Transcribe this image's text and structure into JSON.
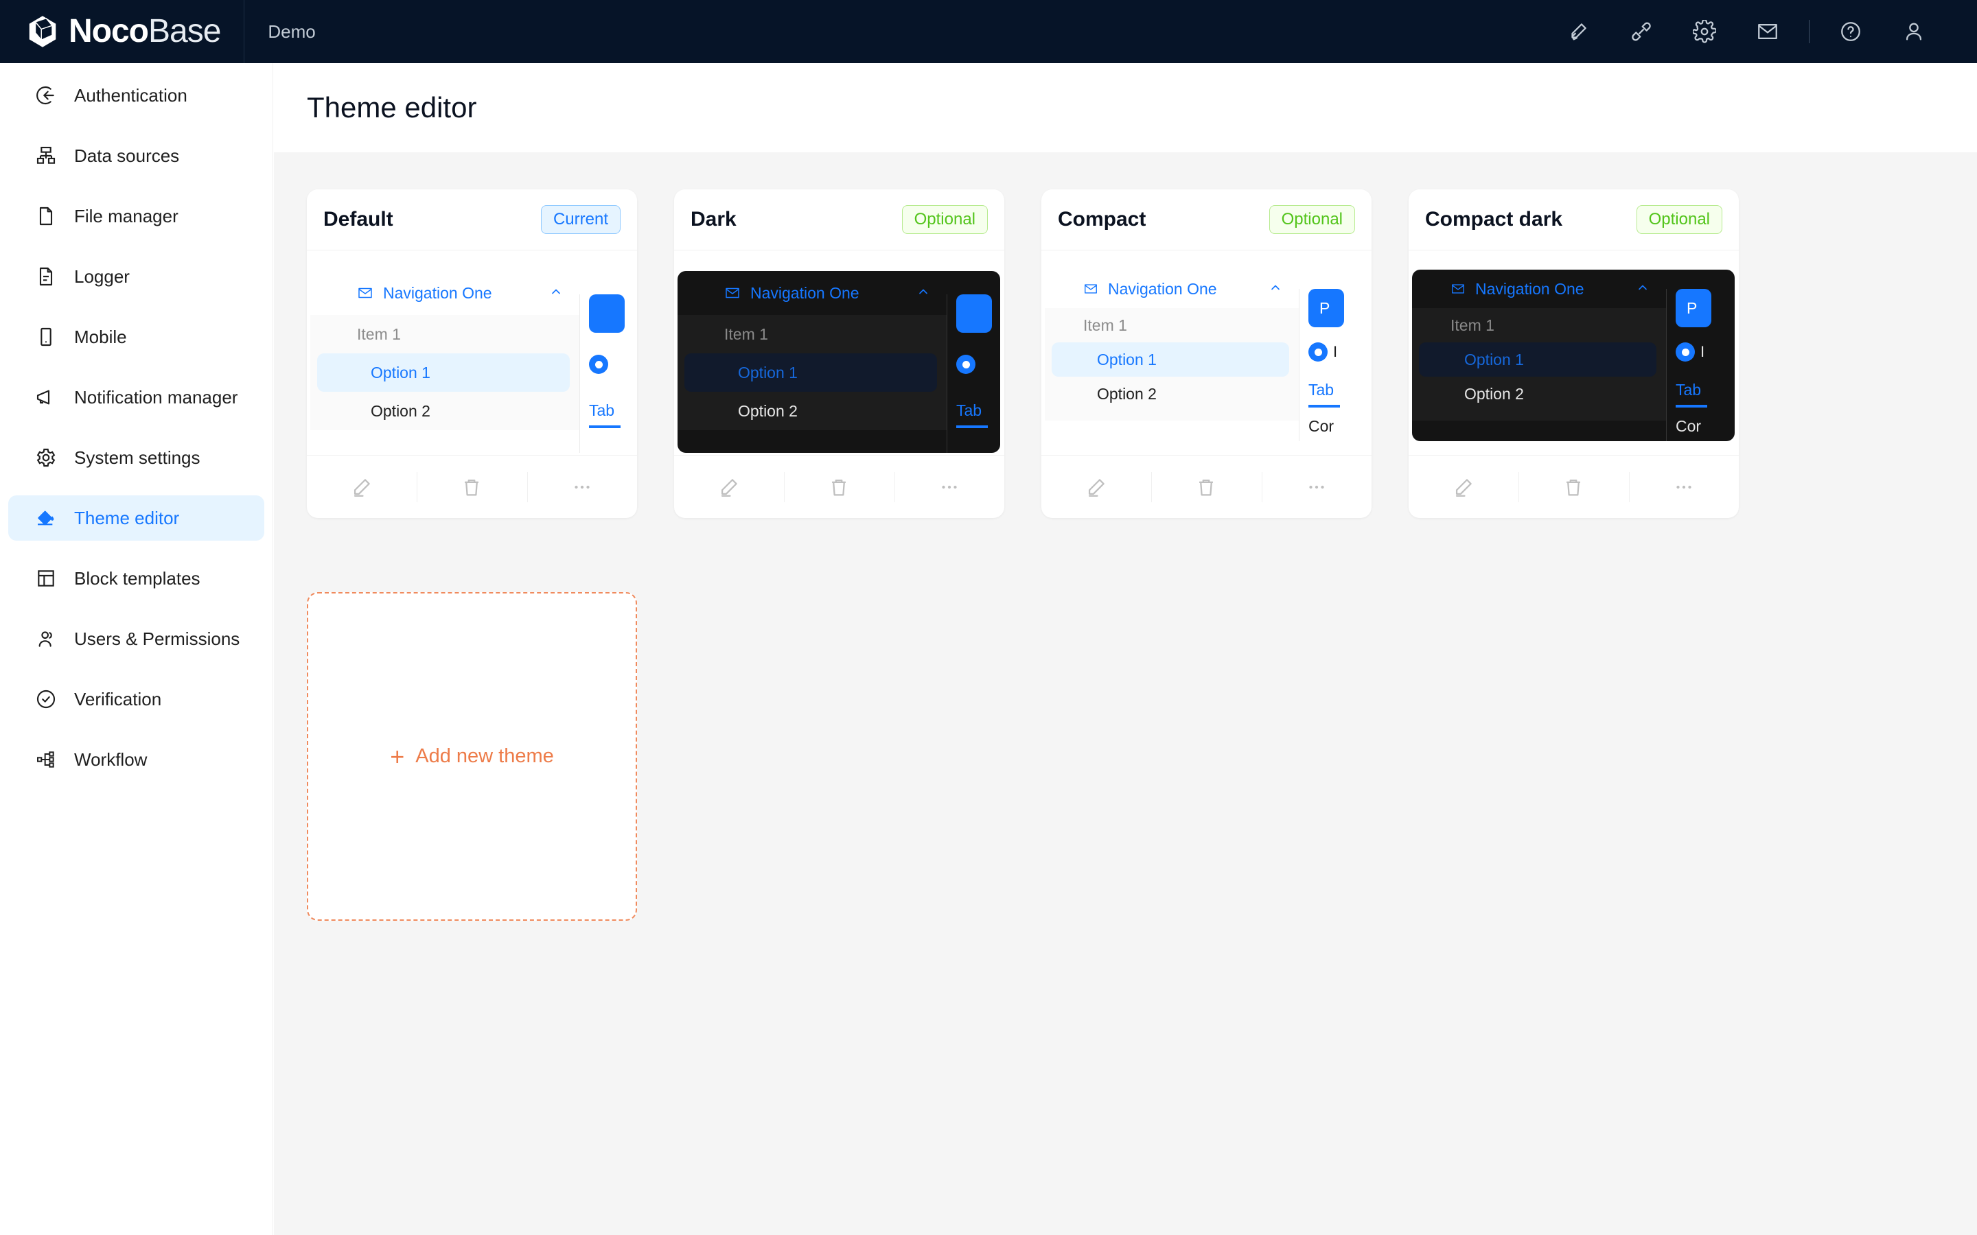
{
  "topbar": {
    "brand_primary": "Noco",
    "brand_secondary": "Base",
    "workspace": "Demo",
    "icons": [
      {
        "name": "highlighter-icon",
        "glyph": "pen"
      },
      {
        "name": "plugin-icon",
        "glyph": "plugin"
      },
      {
        "name": "gear-icon",
        "glyph": "gear"
      },
      {
        "name": "mail-icon",
        "glyph": "mail"
      },
      {
        "name": "help-icon",
        "glyph": "help"
      },
      {
        "name": "user-avatar-icon",
        "glyph": "user"
      }
    ],
    "brand_color": "#061428",
    "accent_color": "#1677ff"
  },
  "sidebar": {
    "items": [
      {
        "label": "Authentication",
        "icon": "login-icon",
        "active": false
      },
      {
        "label": "Data sources",
        "icon": "database-tree-icon",
        "active": false
      },
      {
        "label": "File manager",
        "icon": "file-icon",
        "active": false
      },
      {
        "label": "Logger",
        "icon": "file-lines-icon",
        "active": false
      },
      {
        "label": "Mobile",
        "icon": "mobile-icon",
        "active": false
      },
      {
        "label": "Notification manager",
        "icon": "megaphone-icon",
        "active": false
      },
      {
        "label": "System settings",
        "icon": "gear-icon",
        "active": false
      },
      {
        "label": "Theme editor",
        "icon": "paint-bucket-icon",
        "active": true
      },
      {
        "label": "Block templates",
        "icon": "layout-icon",
        "active": false
      },
      {
        "label": "Users & Permissions",
        "icon": "users-icon",
        "active": false
      },
      {
        "label": "Verification",
        "icon": "check-circle-icon",
        "active": false
      },
      {
        "label": "Workflow",
        "icon": "workflow-icon",
        "active": false
      }
    ],
    "active_bg": "#e6f4ff",
    "active_color": "#1677ff"
  },
  "page": {
    "title": "Theme editor",
    "background": "#f5f5f5"
  },
  "preview_labels": {
    "nav": "Navigation One",
    "item": "Item 1",
    "option1": "Option 1",
    "option2": "Option 2",
    "button": "P",
    "radio": "I",
    "tab": "Tab",
    "tab2": "Cor"
  },
  "card_actions": {
    "edit": "edit-icon",
    "delete": "delete-icon",
    "more": "more-icon"
  },
  "themes": [
    {
      "name": "Default",
      "badge": "Current",
      "badge_type": "current",
      "dark": false,
      "compact": false
    },
    {
      "name": "Dark",
      "badge": "Optional",
      "badge_type": "optional",
      "dark": true,
      "compact": false
    },
    {
      "name": "Compact",
      "badge": "Optional",
      "badge_type": "optional",
      "dark": false,
      "compact": true
    },
    {
      "name": "Compact dark",
      "badge": "Optional",
      "badge_type": "optional",
      "dark": true,
      "compact": true
    }
  ],
  "add_theme": {
    "label": "Add new theme",
    "plus": "+",
    "color": "#ed7b48"
  }
}
